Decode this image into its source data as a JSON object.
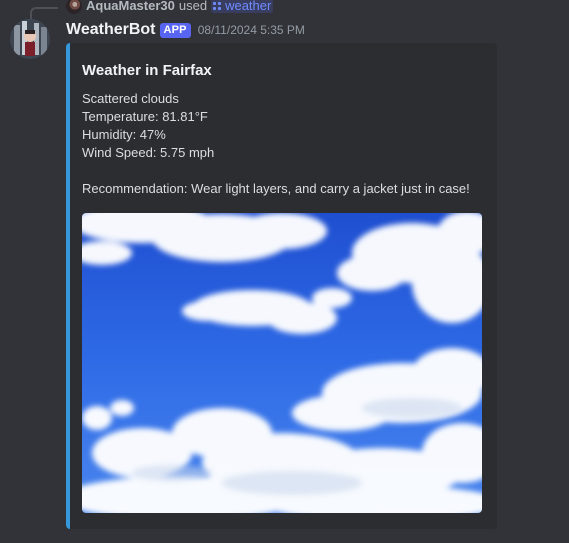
{
  "reply": {
    "username": "AquaMaster30",
    "used_text": "used",
    "command_name": "weather",
    "command_icon": "slash-command-icon"
  },
  "message": {
    "author": "WeatherBot",
    "badge": "APP",
    "timestamp": "08/11/2024 5:35 PM"
  },
  "embed": {
    "accent_color": "#3498db",
    "title": "Weather in Fairfax",
    "description_lines": [
      "Scattered clouds",
      "Temperature: 81.81°F",
      "Humidity: 47%",
      "Wind Speed: 5.75 mph"
    ],
    "recommendation": "Recommendation: Wear light layers, and carry a jacket just in case!",
    "image_icon": "sky-clouds-image"
  },
  "colors": {
    "background": "#313338",
    "embed_background": "#2b2d31",
    "badge": "#5865f2",
    "command_link": "#6e8cff"
  }
}
